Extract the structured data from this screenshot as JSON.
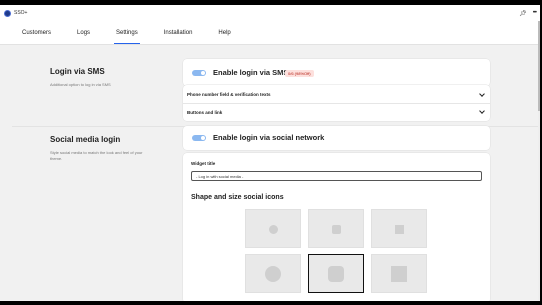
{
  "app": {
    "title": "SSO+",
    "icon": "app-logo-icon"
  },
  "titlebar": {
    "pin_icon": "pin-icon",
    "more_icon": "more-icon"
  },
  "tabs": [
    {
      "label": "Customers",
      "active": false
    },
    {
      "label": "Logs",
      "active": false
    },
    {
      "label": "Settings",
      "active": true
    },
    {
      "label": "Installation",
      "active": false
    },
    {
      "label": "Help",
      "active": false
    }
  ],
  "sms_section": {
    "title": "Login via SMS",
    "description": "Additional option to log in via SMS",
    "toggle_label": "Enable login via SMS",
    "toggle_on": true,
    "badge": "0/6 (98%Off)",
    "rows": [
      {
        "label": "Phone number field & verification texts"
      },
      {
        "label": "Buttons and link"
      }
    ]
  },
  "social_section": {
    "title": "Social media login",
    "description_line1": "Style social media to match the look and feel of your",
    "description_line2": "theme.",
    "toggle_label": "Enable login via social network",
    "toggle_on": true,
    "widget_title_label": "Widget title",
    "widget_title_value": "- Log in with social media -",
    "shape_title": "Shape and size social icons",
    "tiles": [
      {
        "shape": "circle-small",
        "selected": false
      },
      {
        "shape": "rounded-square-small",
        "selected": false
      },
      {
        "shape": "square-small",
        "selected": false
      },
      {
        "shape": "circle-large",
        "selected": false
      },
      {
        "shape": "rounded-square-large",
        "selected": true
      },
      {
        "shape": "square-large",
        "selected": false
      }
    ]
  },
  "colors": {
    "accent": "#2563eb",
    "toggle": "#8bb8f0",
    "badge_bg": "#fde0dd",
    "badge_text": "#b42318"
  }
}
